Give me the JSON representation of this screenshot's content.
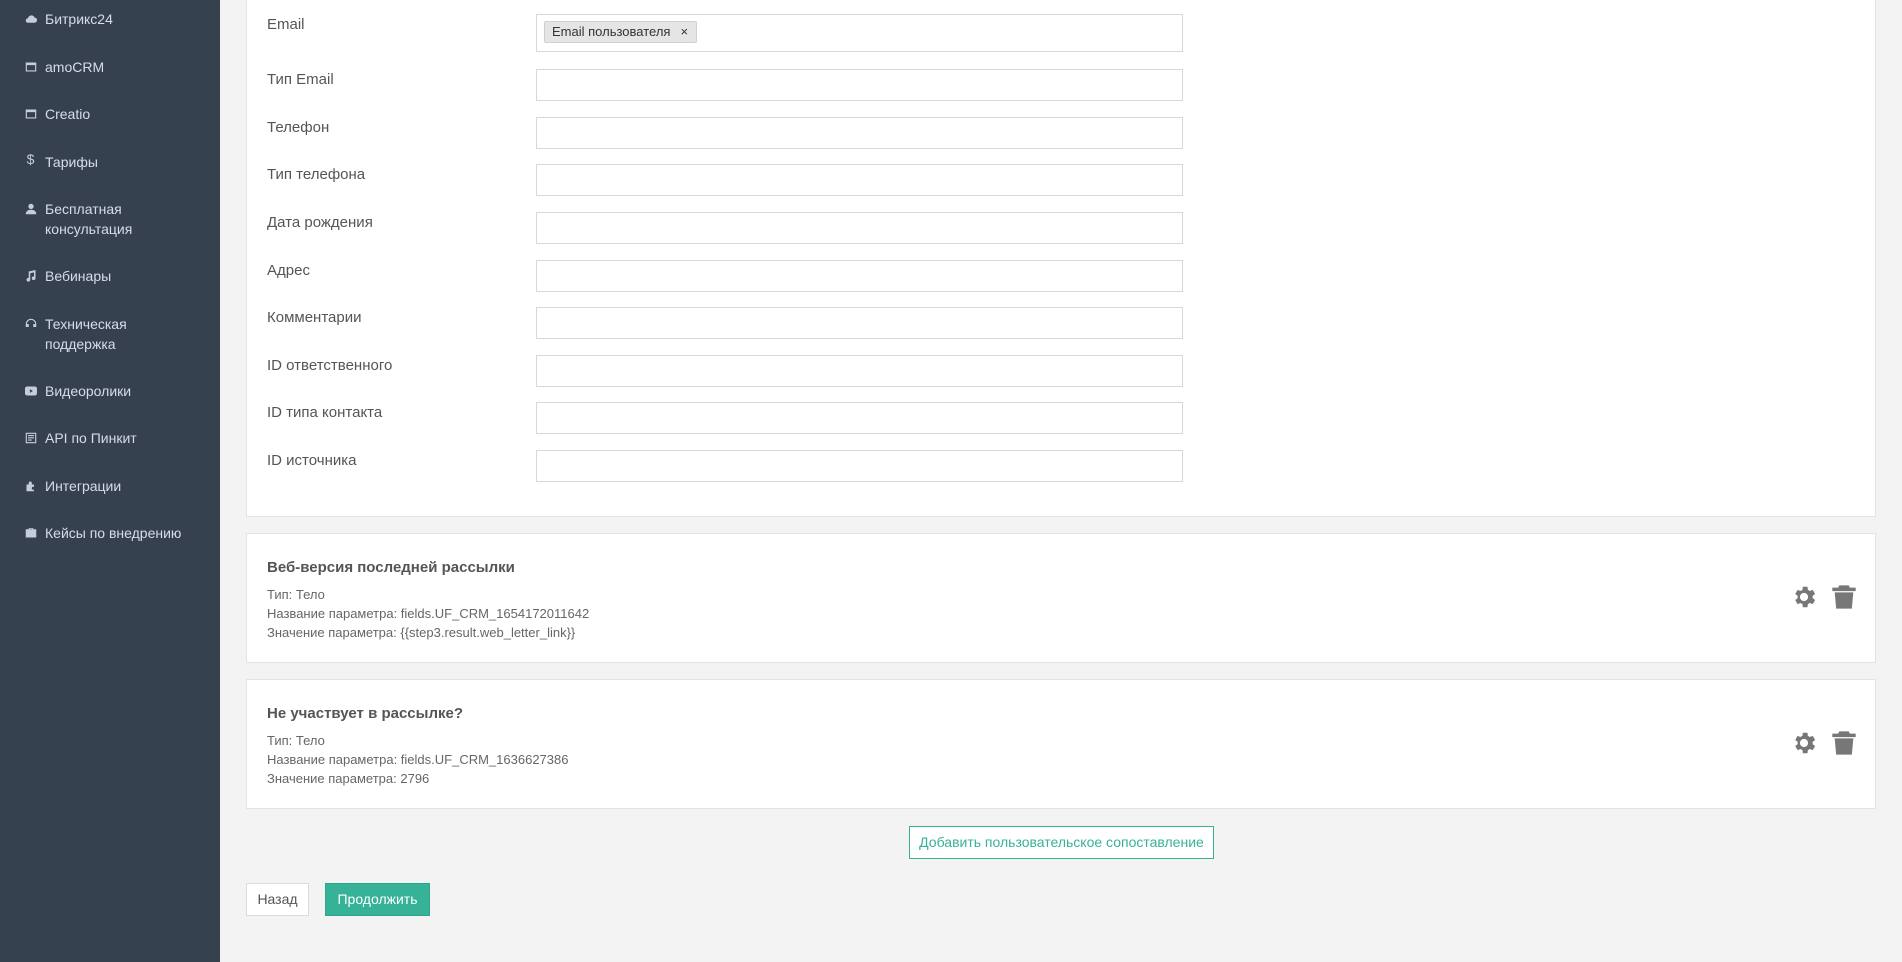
{
  "sidebar": {
    "items": [
      {
        "label": "Битрикс24",
        "icon": "cloud-icon"
      },
      {
        "label": "amoCRM",
        "icon": "window-icon"
      },
      {
        "label": "Creatio",
        "icon": "window-icon"
      },
      {
        "label": "Тарифы",
        "icon": "dollar-icon"
      },
      {
        "label": "Бесплатная",
        "label2": "консультация",
        "icon": "user-icon"
      },
      {
        "label": "Вебинары",
        "icon": "music-icon"
      },
      {
        "label": "Техническая",
        "label2": "поддержка",
        "icon": "headset-icon"
      },
      {
        "label": "Видеоролики",
        "icon": "youtube-icon"
      },
      {
        "label": "API по Пинкит",
        "icon": "api-icon"
      },
      {
        "label": "Интеграции",
        "icon": "puzzle-icon"
      },
      {
        "label": "Кейсы по внедрению",
        "icon": "briefcase-icon"
      }
    ]
  },
  "form": {
    "fields": [
      {
        "label": "Email",
        "value": "",
        "chip": "Email пользователя",
        "chip_remove": "×"
      },
      {
        "label": "Тип Email",
        "value": ""
      },
      {
        "label": "Телефон",
        "value": ""
      },
      {
        "label": "Тип телефона",
        "value": ""
      },
      {
        "label": "Дата рождения",
        "value": ""
      },
      {
        "label": "Адрес",
        "value": ""
      },
      {
        "label": "Комментарии",
        "value": ""
      },
      {
        "label": "ID ответственного",
        "value": ""
      },
      {
        "label": "ID типа контакта",
        "value": ""
      },
      {
        "label": "ID источника",
        "value": ""
      }
    ]
  },
  "mappings": [
    {
      "title": "Веб-версия последней рассылки",
      "type": "Тип: Тело",
      "param_name": "Название параметра: fields.UF_CRM_1654172011642",
      "param_value": "Значение параметра: {{step3.result.web_letter_link}}"
    },
    {
      "title": "Не участвует в рассылке?",
      "type": "Тип: Тело",
      "param_name": "Название параметра: fields.UF_CRM_1636627386",
      "param_value": "Значение параметра: 2796"
    }
  ],
  "actions": {
    "add_mapping": "Добавить пользовательское сопоставление",
    "back": "Назад",
    "continue": "Продолжить"
  },
  "colors": {
    "sidebar_bg": "#364150",
    "accent": "#36b298"
  }
}
